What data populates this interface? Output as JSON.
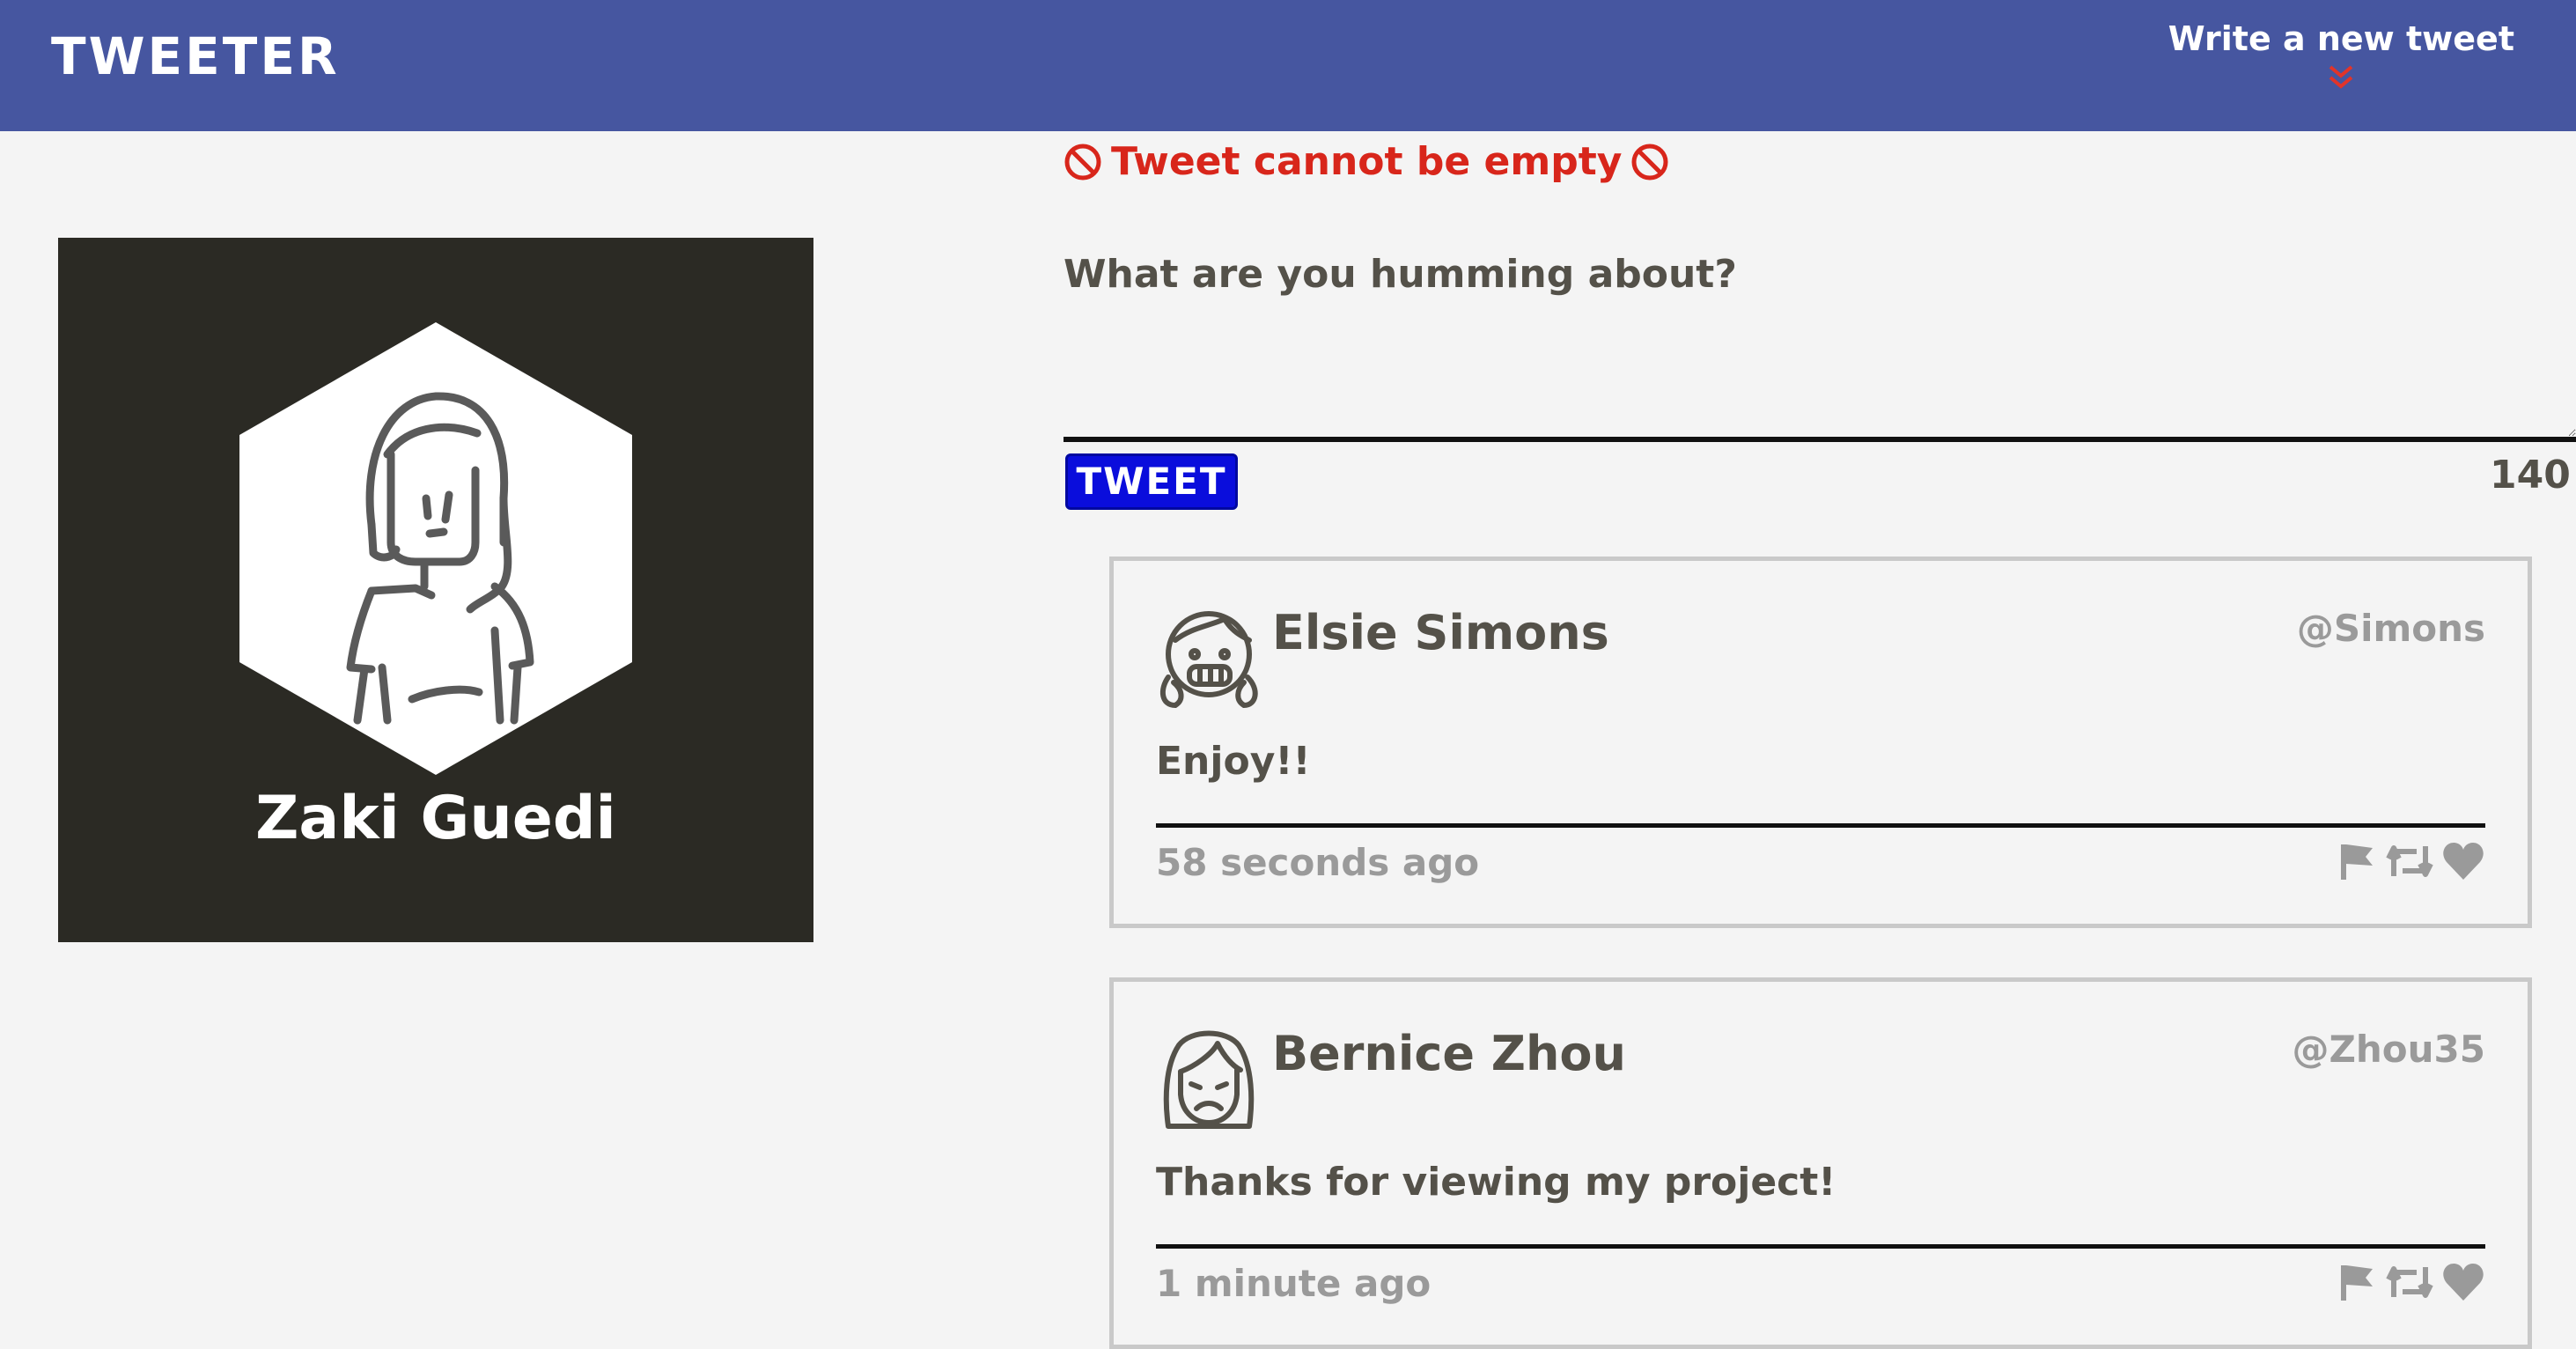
{
  "header": {
    "brand": "TWEETER",
    "compose_link": "Write a new tweet",
    "compose_icon": "double-chevron-down-icon",
    "bar_color": "#4656a0"
  },
  "profile": {
    "name": "Zaki Guedi",
    "avatar_icon": "woman-avatar-icon",
    "card_color": "#2b2a24"
  },
  "composer": {
    "error_text": "Tweet cannot be empty",
    "error_icon": "prohibited-icon",
    "placeholder": "What are you humming about?",
    "submit_label": "TWEET",
    "char_count": "140",
    "error_color": "#d8261b",
    "button_color": "#0a0ddc"
  },
  "tweets": [
    {
      "author": "Elsie Simons",
      "handle": "@Simons",
      "avatar_icon": "girl-grinning-avatar-icon",
      "text": "Enjoy!!",
      "timestamp": "58 seconds ago",
      "actions": [
        "flag-icon",
        "retweet-icon",
        "heart-icon"
      ]
    },
    {
      "author": "Bernice Zhou",
      "handle": "@Zhou35",
      "avatar_icon": "woman-frowning-avatar-icon",
      "text": "Thanks for viewing my project!",
      "timestamp": "1 minute ago",
      "actions": [
        "flag-icon",
        "retweet-icon",
        "heart-icon"
      ]
    }
  ]
}
